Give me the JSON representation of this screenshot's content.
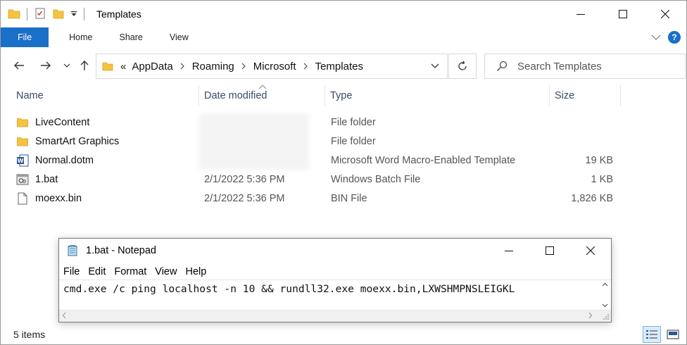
{
  "window": {
    "title": "Templates",
    "minimize": "minimize",
    "maximize": "maximize",
    "close": "close"
  },
  "ribbon": {
    "tabs": [
      "File",
      "Home",
      "Share",
      "View"
    ],
    "help": "?"
  },
  "address": {
    "overflow": "«",
    "crumbs": [
      "AppData",
      "Roaming",
      "Microsoft",
      "Templates"
    ]
  },
  "search": {
    "placeholder": "Search Templates"
  },
  "columns": {
    "name": "Name",
    "date": "Date modified",
    "type": "Type",
    "size": "Size"
  },
  "files": [
    {
      "name": "LiveContent",
      "date": "",
      "type": "File folder",
      "size": "",
      "icon": "folder-icon"
    },
    {
      "name": "SmartArt Graphics",
      "date": "",
      "type": "File folder",
      "size": "",
      "icon": "folder-icon"
    },
    {
      "name": "Normal.dotm",
      "date": "",
      "type": "Microsoft Word Macro-Enabled Template",
      "size": "19 KB",
      "icon": "word-doc-icon"
    },
    {
      "name": "1.bat",
      "date": "2/1/2022 5:36 PM",
      "type": "Windows Batch File",
      "size": "1 KB",
      "icon": "batch-file-icon"
    },
    {
      "name": "moexx.bin",
      "date": "2/1/2022 5:36 PM",
      "type": "BIN File",
      "size": "1,826 KB",
      "icon": "blank-file-icon"
    }
  ],
  "status": {
    "items": "5 items"
  },
  "notepad": {
    "title": "1.bat - Notepad",
    "menu": [
      "File",
      "Edit",
      "Format",
      "View",
      "Help"
    ],
    "content": "cmd.exe /c ping localhost -n 10 && rundll32.exe moexx.bin,LXWSHMPNSLEIGKL"
  },
  "colors": {
    "accent": "#1a6fc9",
    "folder": "#f5c242",
    "folder_dark": "#e0a526"
  }
}
